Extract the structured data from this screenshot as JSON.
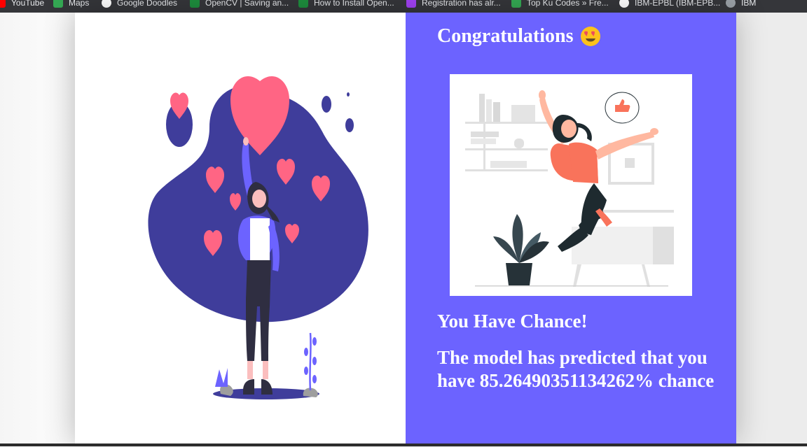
{
  "bookmarks": [
    {
      "label": "YouTube",
      "icon": "youtube-icon",
      "color": "#ff0000"
    },
    {
      "label": "Maps",
      "icon": "maps-icon",
      "color": "#34a853"
    },
    {
      "label": "Google Doodles",
      "icon": "google-icon",
      "color": "#ffffff"
    },
    {
      "label": "OpenCV | Saving an...",
      "icon": "opencv-icon",
      "color": "#1e8e3e"
    },
    {
      "label": "How to Install Open...",
      "icon": "opencv-icon",
      "color": "#1e8e3e"
    },
    {
      "label": "Registration has alr...",
      "icon": "registration-icon",
      "color": "#a142f4"
    },
    {
      "label": "Top Ku Codes » Fre...",
      "icon": "shield-icon",
      "color": "#34a853"
    },
    {
      "label": "IBM-EPBL (IBM-EPB...",
      "icon": "github-icon",
      "color": "#ffffff"
    },
    {
      "label": "IBM",
      "icon": "ibm-icon",
      "color": "#9aa0a6"
    }
  ],
  "result": {
    "title": "Congratulations",
    "chance_heading": "You Have Chance!",
    "prediction": "The model has predicted that you have 85.26490351134262% chance"
  },
  "colors": {
    "accent": "#6c63ff",
    "blob": "#3f3d9b",
    "heart": "#ff6584",
    "shirt": "#f9735b"
  }
}
